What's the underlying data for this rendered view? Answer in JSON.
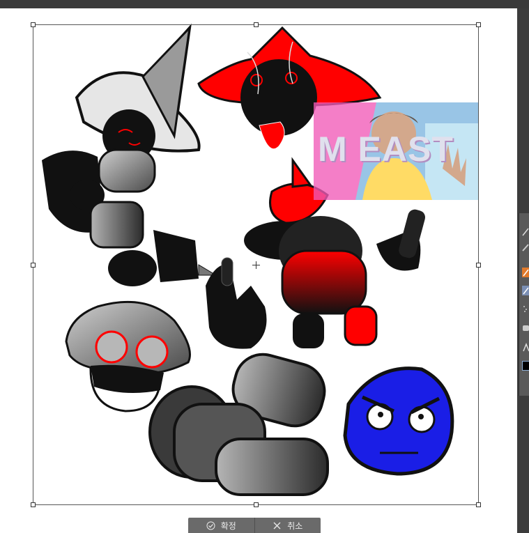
{
  "app": {
    "accent_colors": {
      "red": "#ff0000",
      "blue": "#1a1ee6",
      "panel": "#5a5a5a"
    }
  },
  "photo_overlay": {
    "visible_text": "M   EAST"
  },
  "confirm_bar": {
    "confirm_label": "확정",
    "cancel_label": "취소",
    "confirm_icon": "check-circle-icon",
    "cancel_icon": "close-icon"
  },
  "tool_panel": {
    "icons": [
      "pen-icon",
      "pencil-icon",
      "brush-icon",
      "marker-icon",
      "airbrush-icon",
      "eraser-icon",
      "text-icon",
      "color-swatch-icon"
    ]
  }
}
